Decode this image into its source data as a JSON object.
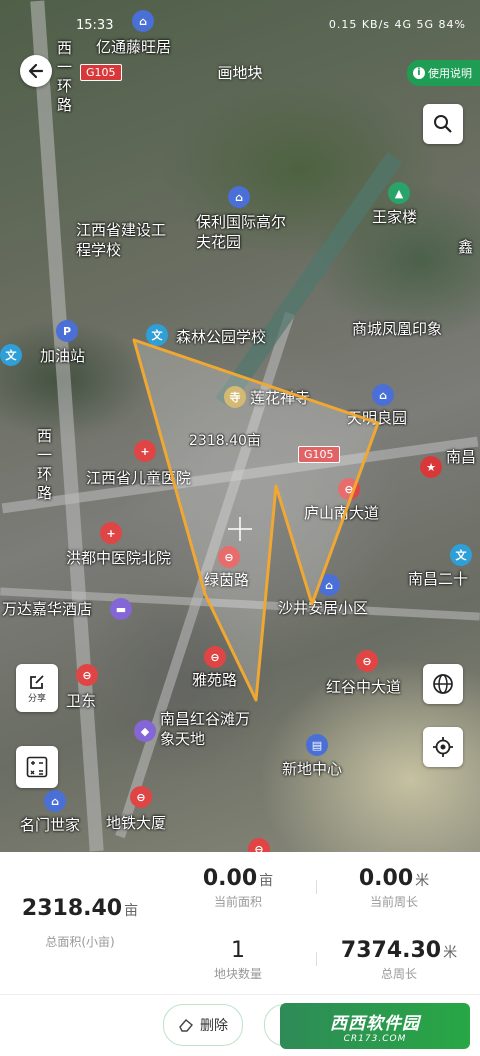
{
  "status_bar": {
    "time": "15:33",
    "indicators": "0.15 KB/s  4G  5G  84%"
  },
  "header": {
    "title": "画地块",
    "usage_label": "使用说明"
  },
  "map": {
    "highway_tag": "G105",
    "area_label": "2318.40亩",
    "pois": [
      "亿通藤旺居",
      "西一环路",
      "江西省建设工程学校",
      "保利国际高尔夫花园",
      "王家楼",
      "森林公园学校",
      "商城凤凰印象",
      "莲花禅寺",
      "天明良园",
      "江西省儿童医院",
      "庐山南大道",
      "洪都中医院北院",
      "绿茵路",
      "沙井安居小区",
      "万达嘉华酒店",
      "雅苑路",
      "红谷中大道",
      "南昌红谷滩万象天地",
      "新地中心",
      "名门世家",
      "地铁大厦",
      "加油站",
      "卫东",
      "南昌二十",
      "南昌",
      "鑫",
      "西一环路"
    ]
  },
  "tools": {
    "share_label": "分享"
  },
  "stats": {
    "total_area": {
      "value": "2318.40",
      "unit": "亩",
      "label": "总面积(小亩)"
    },
    "current_area": {
      "value": "0.00",
      "unit": "亩",
      "label": "当前面积"
    },
    "current_perimeter": {
      "value": "0.00",
      "unit": "米",
      "label": "当前周长"
    },
    "plot_count": {
      "value": "1",
      "label": "地块数量"
    },
    "total_perimeter": {
      "value": "7374.30",
      "unit": "米",
      "label": "总周长"
    }
  },
  "actions": {
    "delete_label": "删除",
    "watermark": "西西软件园",
    "watermark_sub": "CR173.COM"
  }
}
